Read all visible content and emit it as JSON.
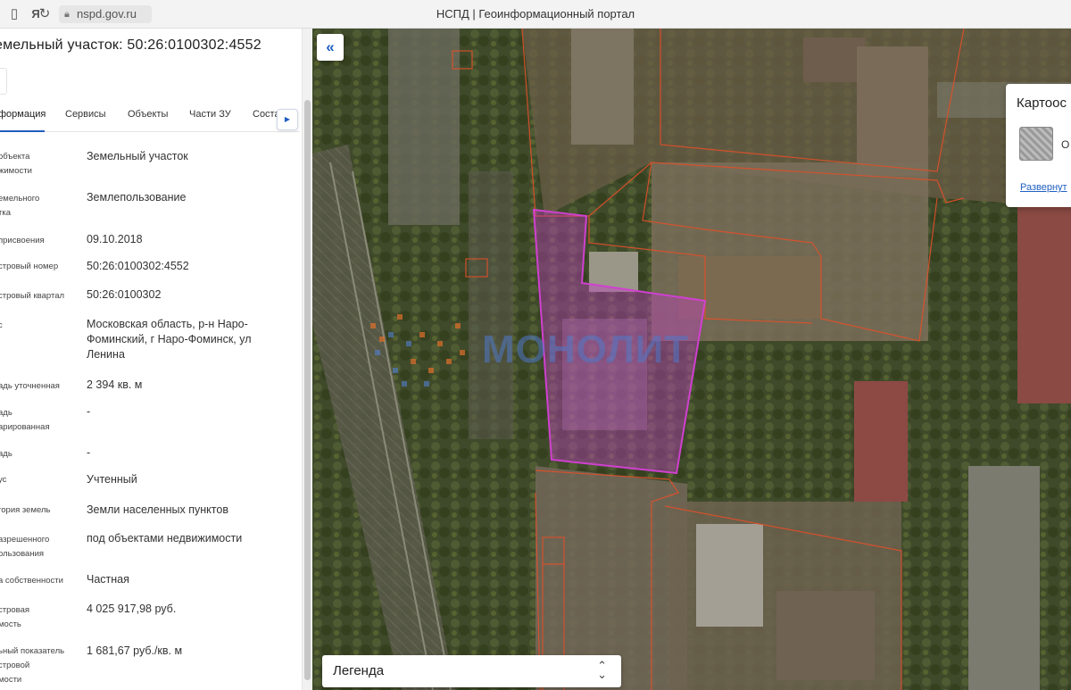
{
  "browser": {
    "url": "nspd.gov.ru",
    "page_title": "НСПД | Геоинформационный портал",
    "yandex_icon": "Я",
    "lock_icon": "lock-icon"
  },
  "panel": {
    "title": "емельный участок: 50:26:0100302:4552",
    "tabs": [
      {
        "label": "формация"
      },
      {
        "label": "Сервисы"
      },
      {
        "label": "Объекты"
      },
      {
        "label": "Части ЗУ"
      },
      {
        "label": "Соста"
      }
    ],
    "rows": [
      {
        "label": "объекта\nжимости",
        "value": "Земельный участок"
      },
      {
        "label": "емельного\nтка",
        "value": "Землепользование"
      },
      {
        "label": "присвоения",
        "value": "09.10.2018"
      },
      {
        "label": "стровый номер",
        "value": "50:26:0100302:4552"
      },
      {
        "label": "стровый квартал",
        "value": "50:26:0100302"
      },
      {
        "label": "с",
        "value": "Московская область, р-н Наро-Фоминский, г Наро-Фоминск, ул Ленина"
      },
      {
        "label": "адь уточненная",
        "value": "2 394 кв. м"
      },
      {
        "label": "адь\nарированная",
        "value": "-"
      },
      {
        "label": "адь",
        "value": "-"
      },
      {
        "label": "ус",
        "value": "Учтенный"
      },
      {
        "label": "гория земель",
        "value": "Земли населенных пунктов"
      },
      {
        "label": "азрешенного\nользования",
        "value": "под объектами недвижимости"
      },
      {
        "label": "а собственности",
        "value": "Частная"
      },
      {
        "label": "стровая\nмость",
        "value": "4 025 917,98 руб."
      },
      {
        "label": "ьный показатель\nстровой\nмости",
        "value": "1 681,67 руб./кв. м"
      }
    ]
  },
  "map": {
    "watermark": "МОНОЛИТ",
    "collapse_icon": "«",
    "card": {
      "title": "Картоос",
      "item_label": "О",
      "link": "Развернут"
    },
    "legend": {
      "label": "Легенда",
      "chevron": "⌃⌄"
    }
  },
  "colors": {
    "accent": "#1f5fc0",
    "parcel_highlight": "#c040c0",
    "cadastral_lines": "#e0502a"
  }
}
